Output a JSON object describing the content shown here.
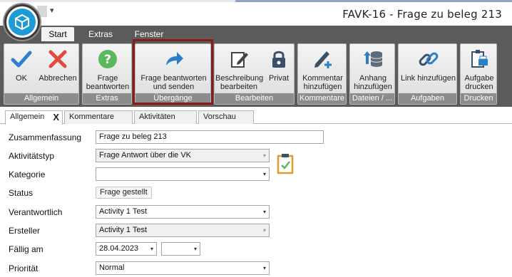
{
  "window": {
    "title": "FAVK-16 - Frage zu beleg 213",
    "qat_arrow": "▾"
  },
  "ribbon": {
    "tabs": [
      {
        "label": "Start",
        "active": true
      },
      {
        "label": "Extras",
        "active": false
      },
      {
        "label": "Fenster",
        "active": false
      }
    ],
    "groups": {
      "allgemein": {
        "label": "Allgemein",
        "ok": "OK",
        "abbrechen": "Abbrechen"
      },
      "extras": {
        "label": "Extras",
        "frage_l1": "Frage",
        "frage_l2": "beantworten"
      },
      "uebergaenge": {
        "label": "Übergänge",
        "l1": "Frage beantworten",
        "l2": "und senden"
      },
      "bearbeiten": {
        "label": "Bearbeiten",
        "beschreibung_l1": "Beschreibung",
        "beschreibung_l2": "bearbeiten",
        "privat": "Privat"
      },
      "kommentare": {
        "label": "Kommentare",
        "l1": "Kommentar",
        "l2": "hinzufügen"
      },
      "dateien": {
        "label": "Dateien / ...",
        "l1": "Anhang",
        "l2": "hinzufügen"
      },
      "aufgaben": {
        "label": "Aufgaben",
        "l1": "Link hinzufügen"
      },
      "drucken": {
        "label": "Drucken",
        "l1": "Aufgabe",
        "l2": "drucken"
      }
    },
    "colors": {
      "ok": "#2f7fd1",
      "cancel": "#e04a3a",
      "help": "#5cb85c",
      "arrow": "#2a7fc7",
      "highlight": "#8b1a1a"
    }
  },
  "doc_tabs": [
    {
      "label": "Allgemein",
      "close": "X"
    },
    {
      "label": "Kommentare"
    },
    {
      "label": "Aktivitäten"
    },
    {
      "label": "Vorschau"
    }
  ],
  "form": {
    "zusammenfassung": {
      "label": "Zusammenfassung",
      "value": "Frage zu beleg 213"
    },
    "aktivitaetstyp": {
      "label": "Aktivitätstyp",
      "value": "Frage Antwort über die VK"
    },
    "kategorie": {
      "label": "Kategorie",
      "value": ""
    },
    "status": {
      "label": "Status",
      "value": "Frage gestellt"
    },
    "verantwortlich": {
      "label": "Verantwortlich",
      "value": "Activity 1 Test"
    },
    "ersteller": {
      "label": "Ersteller",
      "value": "Activity 1 Test"
    },
    "faellig": {
      "label": "Fällig am",
      "date": "28.04.2023",
      "time": ""
    },
    "prioritaet": {
      "label": "Priorität",
      "value": "Normal"
    },
    "dropdown_arrow": "▾"
  }
}
